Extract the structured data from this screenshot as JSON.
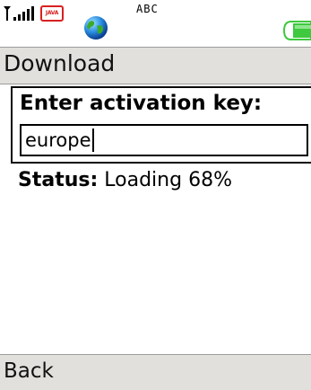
{
  "status_bar": {
    "java_label": "JAVA",
    "input_mode": "ABC",
    "icons": [
      "signal-icon",
      "java-icon",
      "globe-icon",
      "battery-icon"
    ]
  },
  "title_bar": {
    "title": "Download"
  },
  "form": {
    "label": "Enter activation key:",
    "input_value": "europe"
  },
  "status": {
    "key": "Status:",
    "value": "Loading 68%"
  },
  "softkeys": {
    "left": "Back"
  },
  "colors": {
    "bar_background": "#e2e0dc",
    "battery_green": "#3ec93e",
    "java_red": "#d82020"
  }
}
